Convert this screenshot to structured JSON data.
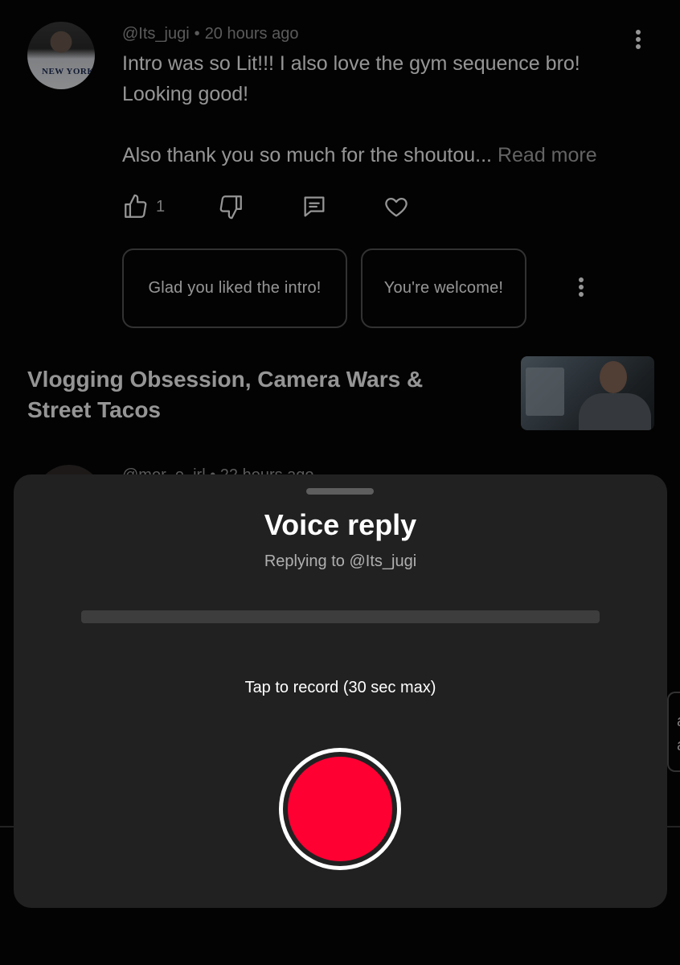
{
  "comment": {
    "handle": "@Its_jugi",
    "separator": "•",
    "time": "20 hours ago",
    "text_line1": "Intro was so Lit!!! I also love the gym sequence bro!",
    "text_line2": "Looking good!",
    "text_line3": "Also thank you so much for the shoutou...",
    "read_more": "Read more",
    "avatar_shirt_text": "NEW YORK",
    "like_count": "1",
    "icons": {
      "like": "thumbs-up-icon",
      "dislike": "thumbs-down-icon",
      "reply": "comment-icon",
      "heart": "heart-icon",
      "more": "more-vert-icon"
    }
  },
  "suggested_replies": [
    "Glad you liked the intro!",
    "You're welcome!"
  ],
  "video": {
    "title": "Vlogging Obsession, Camera Wars & Street Tacos"
  },
  "next_comment": {
    "meta_partial": "@mor_e_irl • 22 hours ago"
  },
  "right_card_partial": [
    "ar",
    "at"
  ],
  "voice_reply": {
    "title": "Voice reply",
    "subtitle": "Replying to @Its_jugi",
    "progress": 0,
    "hint": "Tap to record (30 sec max)",
    "record_color": "#ff0033"
  },
  "colors": {
    "background": "#000000",
    "sheet": "#212121",
    "record": "#ff0033"
  }
}
